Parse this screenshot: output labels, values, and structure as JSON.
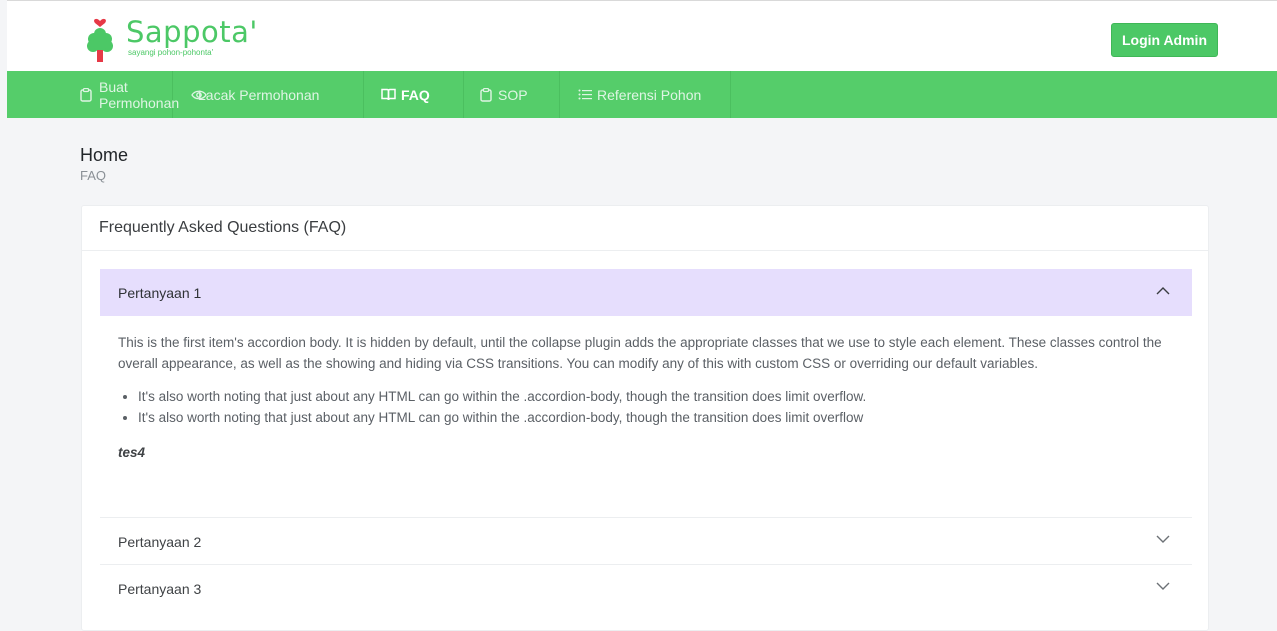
{
  "header": {
    "logo_title": "Sappota'",
    "logo_tagline": "sayangi pohon-pohonta'",
    "login_label": "Login Admin",
    "brand_color": "#4cc866"
  },
  "nav": {
    "items": [
      {
        "label": "Buat Permohonan",
        "icon": "clipboard-icon"
      },
      {
        "label": "Lacak Permohonan",
        "icon": "eye-icon"
      },
      {
        "label": "FAQ",
        "icon": "book-icon",
        "active": true
      },
      {
        "label": "SOP",
        "icon": "clipboard-icon"
      },
      {
        "label": "Referensi Pohon",
        "icon": "list-icon"
      }
    ]
  },
  "page": {
    "title": "Home",
    "breadcrumb": "FAQ"
  },
  "faq": {
    "card_title": "Frequently Asked Questions (FAQ)",
    "items": [
      {
        "question": "Pertanyaan 1",
        "expanded": true,
        "body_text": "This is the first item's accordion body. It is hidden by default, until the collapse plugin adds the appropriate classes that we use to style each element. These classes control the overall appearance, as well as the showing and hiding via CSS transitions. You can modify any of this with custom CSS or overriding our default variables.",
        "bullets": [
          "It's also worth noting that just about any HTML can go within the .accordion-body, though the transition does limit overflow.",
          "It's also worth noting that just about any HTML can go within the .accordion-body, though the transition does limit overflow"
        ],
        "emphasis": "tes4"
      },
      {
        "question": "Pertanyaan 2",
        "expanded": false
      },
      {
        "question": "Pertanyaan 3",
        "expanded": false
      }
    ]
  }
}
